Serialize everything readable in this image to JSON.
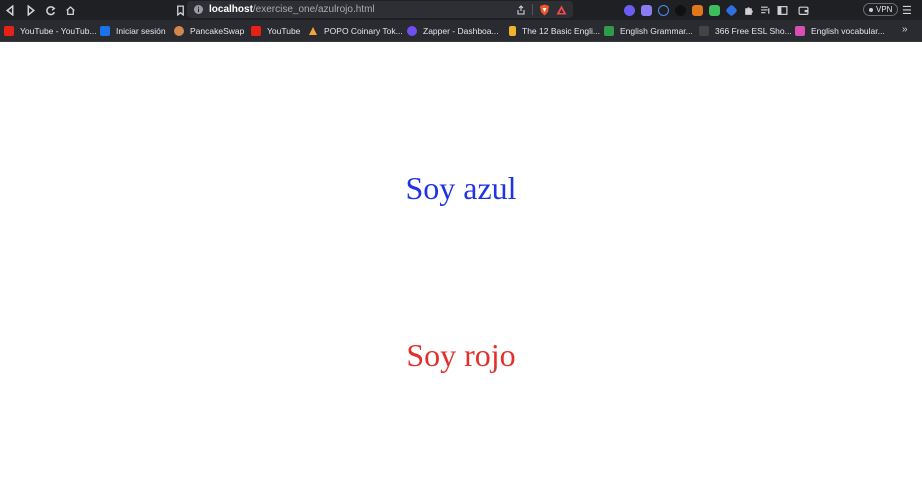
{
  "browser": {
    "url_host": "localhost",
    "url_path": "/exercise_one/azulrojo.html",
    "vpn_label": "VPN"
  },
  "bookmarks": [
    {
      "label": "YouTube - YouTub...",
      "icon": "youtube-icon",
      "color": "#e62117"
    },
    {
      "label": "Iniciar sesión",
      "icon": "outlook-icon",
      "color": "#1a73e8"
    },
    {
      "label": "PancakeSwap",
      "icon": "pancakeswap-icon",
      "color": "#d1884f"
    },
    {
      "label": "YouTube",
      "icon": "youtube-icon",
      "color": "#e62117"
    },
    {
      "label": "POPO Coinary Tok...",
      "icon": "popo-icon",
      "color": "#f2a33a"
    },
    {
      "label": "Zapper - Dashboa...",
      "icon": "zapper-icon",
      "color": "#6f4ef2"
    },
    {
      "label": "The 12 Basic Engli...",
      "icon": "document-icon",
      "color": "#f0b429"
    },
    {
      "label": "English Grammar...",
      "icon": "grammar-icon",
      "color": "#2e9b4a"
    },
    {
      "label": "366 Free ESL Sho...",
      "icon": "esl-icon",
      "color": "#444444"
    },
    {
      "label": "English vocabular...",
      "icon": "vocabulary-icon",
      "color": "#d64fb4"
    }
  ],
  "page": {
    "blue_text": "Soy azul",
    "red_text": "Soy rojo"
  }
}
